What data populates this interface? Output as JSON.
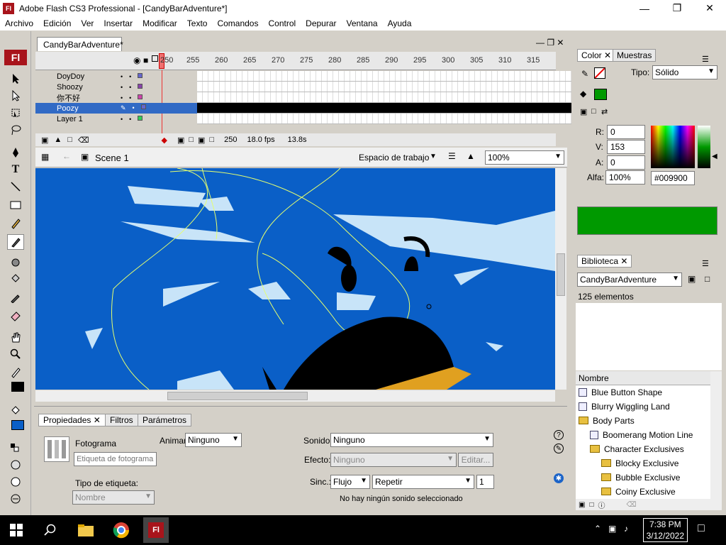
{
  "window": {
    "title": "Adobe Flash CS3 Professional - [CandyBarAdventure*]",
    "app_icon": "Fl"
  },
  "menu": [
    "Archivo",
    "Edición",
    "Ver",
    "Insertar",
    "Modificar",
    "Texto",
    "Comandos",
    "Control",
    "Depurar",
    "Ventana",
    "Ayuda"
  ],
  "document": {
    "tab_label": "CandyBarAdventure*"
  },
  "timeline": {
    "ticks": [
      "250",
      "255",
      "260",
      "265",
      "270",
      "275",
      "280",
      "285",
      "290",
      "295",
      "300",
      "305",
      "310",
      "315"
    ],
    "layers": [
      {
        "name": "DoyDoy",
        "color": "#6666cc",
        "selected": false
      },
      {
        "name": "Shoozy",
        "color": "#8844aa",
        "selected": false
      },
      {
        "name": "你不好",
        "color": "#cc44aa",
        "selected": false
      },
      {
        "name": "Poozy",
        "color": "#6666cc",
        "selected": true
      },
      {
        "name": "Layer 1",
        "color": "#33cc55",
        "selected": false
      }
    ],
    "footer": {
      "frame": "250",
      "fps": "18.0 fps",
      "time": "13.8s"
    }
  },
  "scene": {
    "name": "Scene 1",
    "workspace": "Espacio de trabajo",
    "zoom": "100%"
  },
  "properties": {
    "tabs": [
      "Propiedades",
      "Filtros",
      "Parámetros"
    ],
    "frame_label": "Fotograma",
    "frame_label_placeholder": "Etiqueta de fotograma",
    "tween_label": "Animar:",
    "tween_value": "Ninguno",
    "label_type": "Tipo de etiqueta:",
    "label_type_value": "Nombre",
    "sound_label": "Sonido:",
    "sound_value": "Ninguno",
    "effect_label": "Efecto:",
    "effect_value": "Ninguno",
    "edit_button": "Editar...",
    "sync_label": "Sinc.:",
    "sync_value": "Flujo",
    "repeat_value": "Repetir",
    "repeat_count": "1",
    "status": "No hay ningún sonido seleccionado"
  },
  "color_panel": {
    "tabs": [
      "Color",
      "Muestras"
    ],
    "type_label": "Tipo:",
    "type_value": "Sólido",
    "r_label": "R:",
    "r": "0",
    "g_label": "V:",
    "g": "153",
    "b_label": "A:",
    "b": "0",
    "alpha_label": "Alfa:",
    "alpha": "100%",
    "hex": "#009900",
    "swatch_color": "#009900"
  },
  "library": {
    "tab": "Biblioteca",
    "doc": "CandyBarAdventure",
    "count": "125 elementos",
    "column": "Nombre",
    "items": [
      {
        "name": "Blue Button Shape",
        "kind": "symbol",
        "indent": 0
      },
      {
        "name": "Blurry Wiggling Land",
        "kind": "symbol",
        "indent": 0
      },
      {
        "name": "Body Parts",
        "kind": "folder",
        "indent": 0
      },
      {
        "name": "Boomerang Motion Line",
        "kind": "symbol",
        "indent": 1
      },
      {
        "name": "Character Exclusives",
        "kind": "folder",
        "indent": 1
      },
      {
        "name": "Blocky Exclusive",
        "kind": "folder",
        "indent": 2
      },
      {
        "name": "Bubble Exclusive",
        "kind": "folder",
        "indent": 2
      },
      {
        "name": "Coiny Exclusive",
        "kind": "folder",
        "indent": 2
      }
    ]
  },
  "taskbar": {
    "time": "7:38 PM",
    "date": "3/12/2022"
  }
}
